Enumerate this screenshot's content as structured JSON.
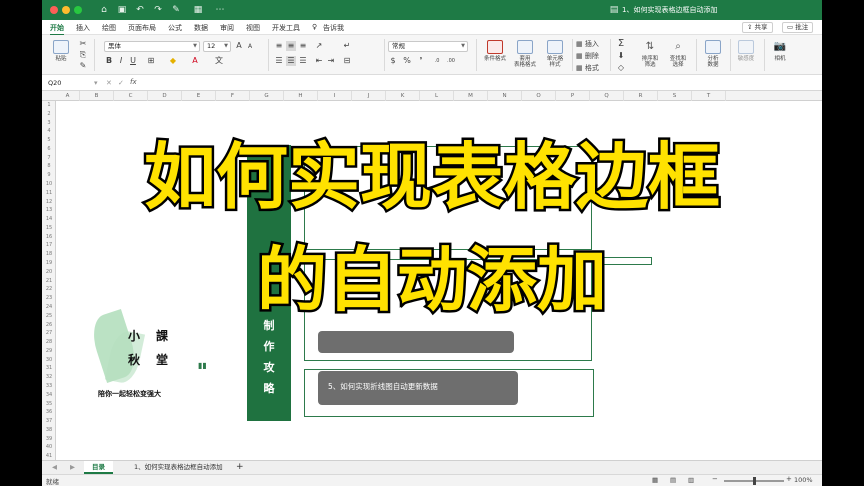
{
  "window": {
    "title": "1、如何实现表格边框自动添加"
  },
  "ribbon_tabs": [
    "开始",
    "插入",
    "绘图",
    "页面布局",
    "公式",
    "数据",
    "审阅",
    "视图",
    "开发工具"
  ],
  "tell_me": "告诉我",
  "share_label": "共享",
  "comment_label": "批注",
  "home": {
    "paste_label": "粘贴",
    "font_name": "黑体",
    "font_size": "12",
    "number_format": "常规",
    "conditional_format": "条件格式",
    "table_format": "套用\n表格格式",
    "cell_style": "单元格\n样式",
    "insert": "插入",
    "delete": "删除",
    "format": "格式",
    "sort_filter": "排序和\n筛选",
    "find_select": "查找和\n选择",
    "analyze": "分析\n数据",
    "sensitivity": "敏感度",
    "camera": "相机"
  },
  "formula_bar": {
    "name_box": "Q20",
    "fx": "fx"
  },
  "columns": [
    "A",
    "B",
    "C",
    "D",
    "E",
    "F",
    "G",
    "H",
    "I",
    "J",
    "K",
    "L",
    "M",
    "N",
    "O",
    "P",
    "Q",
    "R",
    "S",
    "T"
  ],
  "rows": [
    "1",
    "2",
    "3",
    "4",
    "5",
    "6",
    "7",
    "8",
    "9",
    "10",
    "11",
    "12",
    "13",
    "14",
    "15",
    "16",
    "17",
    "18",
    "19",
    "20",
    "21",
    "22",
    "23",
    "24",
    "25",
    "26",
    "27",
    "28",
    "29",
    "30",
    "31",
    "32",
    "33",
    "34",
    "35",
    "36",
    "37",
    "38",
    "39",
    "40",
    "41"
  ],
  "content": {
    "vertical_title": [
      "制",
      "作",
      "攻",
      "略"
    ],
    "item5": "5、如何实现折线图自动更新数据",
    "logo_chars": [
      "小",
      "課",
      "秋",
      "堂"
    ],
    "logo_slogan": "陪你一起轻松变强大"
  },
  "caption": {
    "line1": "如何实现表格边框",
    "line2": "的自动添加"
  },
  "sheets": [
    "目录",
    "1、如何实现表格边框自动添加"
  ],
  "status": {
    "ready": "就绪",
    "zoom": "100%",
    "zoom_level": 1.0
  },
  "colors": {
    "excel_green": "#1e7a45",
    "banner_green": "#1f7240",
    "caption_yellow": "#ffe200"
  }
}
